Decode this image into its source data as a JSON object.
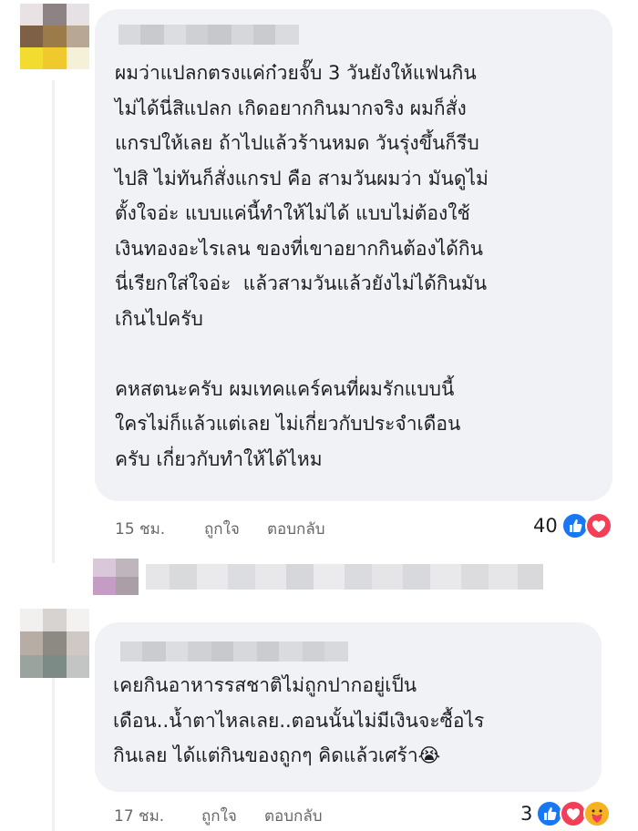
{
  "colors": {
    "bubble": "#f0f2f5",
    "meta_text": "#65676b",
    "like_blue": "#1877f2",
    "love_red": "#f33e58",
    "care_yellow": "#f7b125"
  },
  "comments": [
    {
      "author_blurred": true,
      "avatar_blurred": true,
      "lines": [
        "ผมว่าแปลกตรงแค่ก๋วยจั๊บ 3 วันยังให้แฟนกิน",
        "ไม่ได้นี่สิแปลก เกิดอยากกินมากจริง ผมก็สั่ง",
        "แกรปให้เลย ถ้าไปแล้วร้านหมด วันรุ่งขึ้นก็รีบ",
        "ไปสิ ไม่ทันก็สั่งแกรป คือ สามวันผมว่า มันดูไม่",
        "ตั้งใจอ่ะ แบบแค่นี้ทำให้ไม่ได้ แบบไม่ต้องใช้",
        "เงินทองอะไรเลน ของที่เขาอยากกินต้องได้กิน",
        "นี่เรียกใส่ใจอ่ะ  แล้วสามวันแล้วยังไม่ได้กินมัน",
        "เกินไปครับ",
        "",
        "คหสตนะครับ ผมเทคแคร์คนที่ผมรักแบบนี้",
        "ใครไม่ก็แล้วแต่เลย ไม่เกี่ยวกับประจำเดือน",
        "ครับ เกี่ยวกับทำให้ได้ไหม"
      ],
      "time": "15 ชม.",
      "like_label": "ถูกใจ",
      "reply_label": "ตอบกลับ",
      "reaction_count": "40",
      "reaction_icons": [
        "like-icon",
        "love-icon"
      ]
    },
    {
      "author_blurred": true,
      "avatar_blurred": true,
      "lines": [
        "เคยกินอาหารรสชาติไม่ถูกปากอยู่เป็น",
        "เดือน..น้ำตาไหลเลย..ตอนนั้นไม่มีเงินจะซื้อไร",
        "กินเลย ได้แต่กินของถูกๆ คิดแล้วเศร้า😭"
      ],
      "time": "17 ชม.",
      "like_label": "ถูกใจ",
      "reply_label": "ตอบกลับ",
      "reaction_count": "3",
      "reaction_icons": [
        "like-icon",
        "love-icon",
        "care-icon"
      ]
    }
  ],
  "reply_preview": {
    "blurred": true
  }
}
